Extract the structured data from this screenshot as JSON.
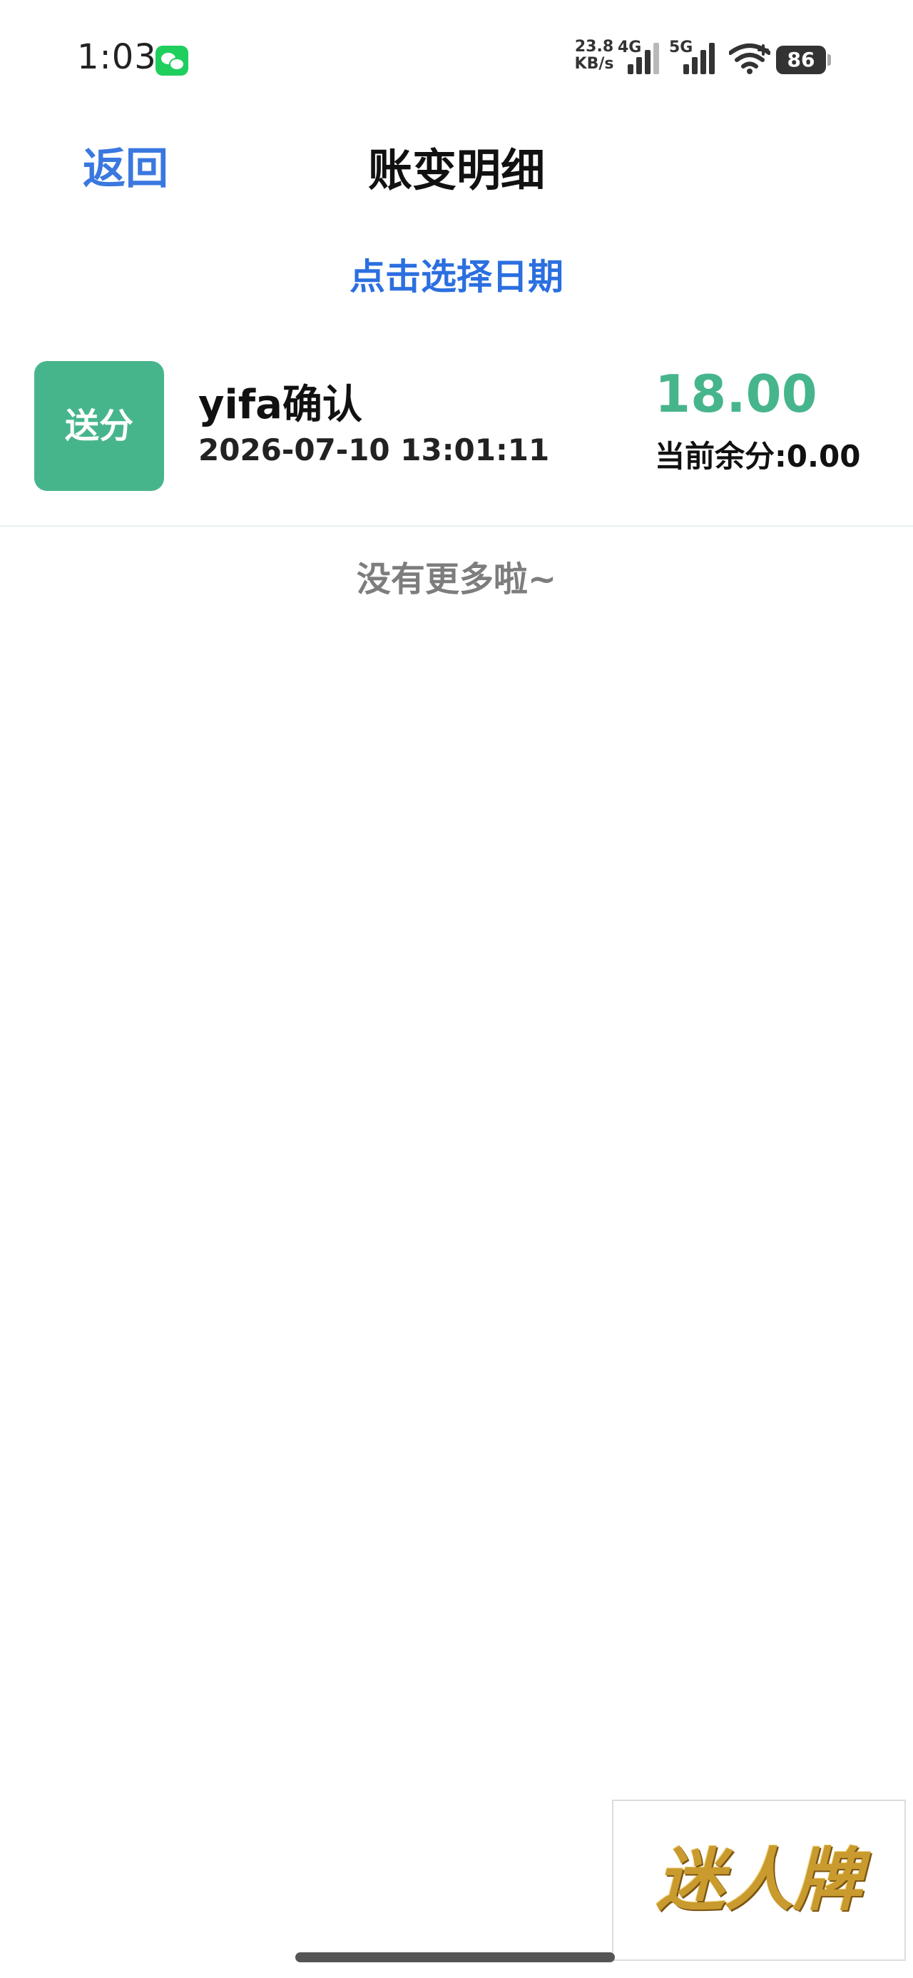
{
  "status_bar": {
    "time": "1:03",
    "net_speed_value": "23.8",
    "net_speed_unit": "KB/s",
    "net1_label": "4G",
    "net2_label": "5G",
    "battery": "86"
  },
  "header": {
    "back_label": "返回",
    "title": "账变明细"
  },
  "filter": {
    "date_label": "点击选择日期"
  },
  "records": [
    {
      "badge": "送分",
      "title": "yifa确认",
      "time": "2026-07-10 13:01:11",
      "amount": "18.00",
      "balance": "当前余分:0.00"
    }
  ],
  "list_end_text": "没有更多啦~",
  "logo_text": "迷人牌",
  "colors": {
    "accent_blue": "#2b6fe0",
    "badge_green": "#47b58c",
    "muted_gray": "#7d7d7d"
  }
}
